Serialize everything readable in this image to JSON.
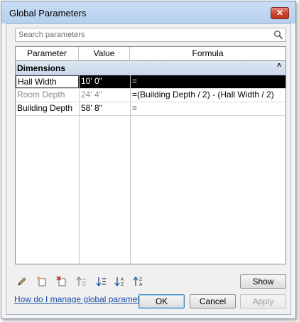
{
  "window": {
    "title": "Global Parameters",
    "close_glyph": "✕"
  },
  "search": {
    "placeholder": "Search parameters",
    "icon": "search-icon"
  },
  "table": {
    "columns": [
      "Parameter",
      "Value",
      "Formula"
    ],
    "group": {
      "label": "Dimensions",
      "collapse_glyph": "˄"
    },
    "rows": [
      {
        "parameter": "Hall Width",
        "value": "10'  0\"",
        "formula": "=",
        "selected": true
      },
      {
        "parameter": "Room Depth",
        "value": "24'  4\"",
        "formula": "=(Building Depth / 2) - (Hall Width / 2)",
        "dimmed": true
      },
      {
        "parameter": "Building Depth",
        "value": "58'  8\"",
        "formula": "="
      }
    ]
  },
  "toolbar": {
    "icons": [
      "edit-icon",
      "new-parameter-icon",
      "delete-parameter-icon",
      "move-up-icon",
      "move-down-icon",
      "sort-ascending-icon",
      "sort-descending-icon"
    ],
    "show_label": "Show"
  },
  "footer": {
    "help_link": "How do I manage global parameters?",
    "ok_label": "OK",
    "cancel_label": "Cancel",
    "apply_label": "Apply"
  }
}
